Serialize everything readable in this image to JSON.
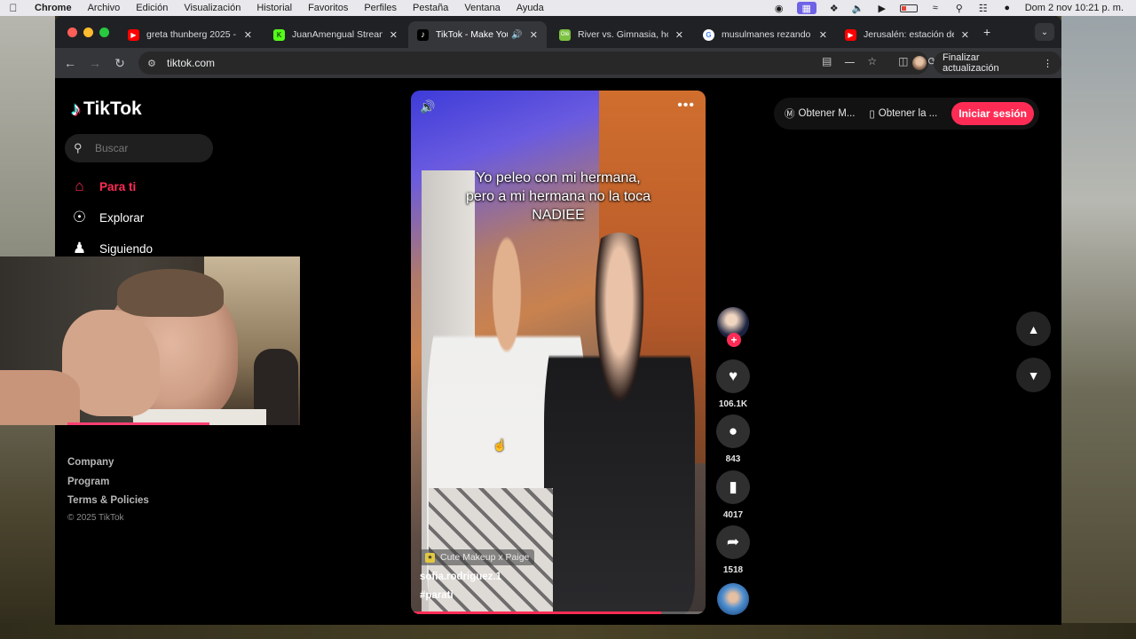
{
  "menubar": {
    "app": "Chrome",
    "menus": [
      "Archivo",
      "Edición",
      "Visualización",
      "Historial",
      "Favoritos",
      "Perfiles",
      "Pestaña",
      "Ventana",
      "Ayuda"
    ],
    "datetime": "Dom 2 nov  10:21 p. m."
  },
  "tabs": [
    {
      "title": "greta thunberg 2025 -",
      "favicon_color": "#ff0000",
      "favicon": "youtube-icon"
    },
    {
      "title": "JuanAmengual Stream",
      "favicon_color": "#53fc18",
      "favicon": "kick-icon",
      "favicon_text": "K"
    },
    {
      "title": "TikTok - Make Your",
      "favicon_color": "#000000",
      "favicon": "tiktok-icon",
      "active": true
    },
    {
      "title": "River vs. Gimnasia, hoy",
      "favicon_color": "#7cc242",
      "favicon": "ole-icon",
      "favicon_text": "Olé"
    },
    {
      "title": "musulmanes rezando",
      "favicon_color": "#ffffff",
      "favicon": "google-icon",
      "favicon_text": "G"
    },
    {
      "title": "Jerusalén: estación de",
      "favicon_color": "#ff0000",
      "favicon": "youtube-icon"
    }
  ],
  "toolbar": {
    "url": "tiktok.com",
    "update_label": "Finalizar actualización"
  },
  "sidebar": {
    "logo": "TikTok",
    "search_placeholder": "Buscar",
    "nav": [
      {
        "label": "Para ti",
        "icon": "home-icon",
        "active": true
      },
      {
        "label": "Explorar",
        "icon": "compass-icon"
      },
      {
        "label": "Siguiendo",
        "icon": "following-icon"
      }
    ],
    "footer": [
      "Company",
      "Program",
      "Terms & Policies"
    ],
    "copyright": "© 2025 TikTok"
  },
  "video": {
    "caption_lines": [
      "Yo peleo con mi hermana,",
      "pero a mi hermana no la toca",
      "NADIEE"
    ],
    "music": "Cute Makeup x Paige",
    "author": "sofia.rodriguez.1",
    "hashtag": "#parati",
    "progress": 0.85
  },
  "actions": {
    "likes": "106.1K",
    "comments": "843",
    "saves": "4017",
    "shares": "1518"
  },
  "topright": {
    "get_coins": "Obtener M...",
    "get_app": "Obtener la ...",
    "login": "Iniciar sesión"
  },
  "colors": {
    "tiktok_red": "#fe2c55",
    "tiktok_cyan": "#25f4ee"
  }
}
